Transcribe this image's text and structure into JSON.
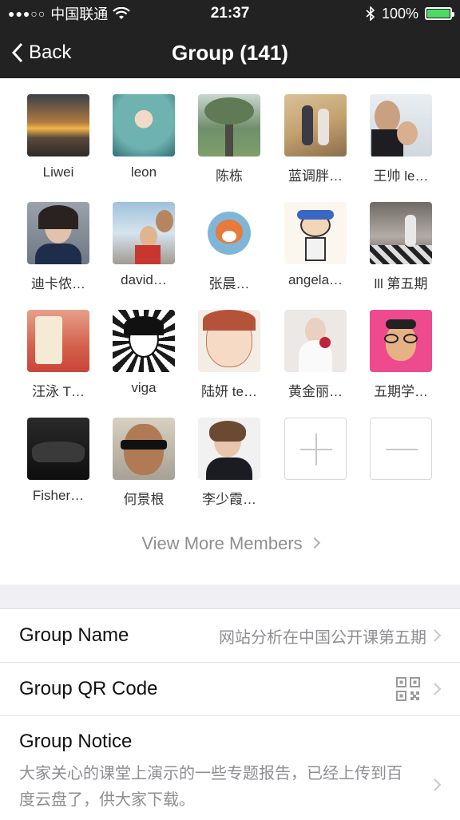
{
  "status_bar": {
    "carrier": "中国联通",
    "time": "21:37",
    "battery": "100%",
    "colors": {
      "battery": "#4cd964"
    }
  },
  "nav": {
    "back_label": "Back",
    "title": "Group (141)"
  },
  "members": [
    {
      "name": "Liwei"
    },
    {
      "name": "leon"
    },
    {
      "name": "陈栋"
    },
    {
      "name": "蓝调胖…"
    },
    {
      "name": "王帅 le…"
    },
    {
      "name": "迪卡侬…"
    },
    {
      "name": "david…"
    },
    {
      "name": "张晨…"
    },
    {
      "name": "angela…"
    },
    {
      "name": "lll 第五期"
    },
    {
      "name": "汪泳 T…"
    },
    {
      "name": "viga"
    },
    {
      "name": "陆妍 te…"
    },
    {
      "name": "黄金丽…"
    },
    {
      "name": "五期学…"
    },
    {
      "name": "Fisher…"
    },
    {
      "name": "何景根"
    },
    {
      "name": "李少霞…"
    }
  ],
  "view_more": "View More Members",
  "settings": {
    "group_name_label": "Group Name",
    "group_name_value": "网站分析在中国公开课第五期",
    "qr_label": "Group QR Code",
    "notice_label": "Group Notice",
    "notice_text": "大家关心的课堂上演示的一些专题报告，已经上传到百度云盘了，供大家下载。"
  },
  "icons": [
    "back-chevron-icon",
    "wifi-icon",
    "bluetooth-icon",
    "battery-icon",
    "add-member-icon",
    "remove-member-icon",
    "qr-code-icon",
    "chevron-right-icon"
  ]
}
